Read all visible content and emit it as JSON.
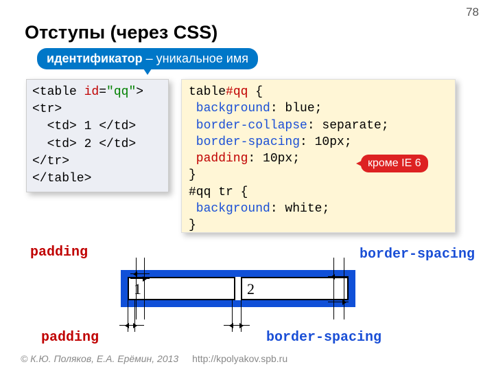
{
  "page_number": "78",
  "title": "Отступы (через CSS)",
  "callout_top": {
    "id_word": "идентификатор",
    "rest": " – уникальное имя"
  },
  "html_code": {
    "l1a": "<table ",
    "l1b": "id",
    "l1c": "=",
    "l1d": "\"qq\"",
    "l1e": ">",
    "l2": "<tr>",
    "l3": "  <td> 1 </td>",
    "l4": "  <td> 2 </td>",
    "l5": "</tr>",
    "l6": "</table>"
  },
  "css_code": {
    "l1a": "table",
    "l1b": "#qq",
    "l1c": " {",
    "l2a": " background",
    "l2b": ": blue;",
    "l3a": " border-collapse",
    "l3b": ": separate;",
    "l4a": " border-spacing",
    "l4b": ": 10px;",
    "l5a": " padding",
    "l5b": ": 10px;",
    "l6": "}",
    "l7": "#qq tr {",
    "l8a": " background",
    "l8b": ": white;",
    "l9": "}"
  },
  "callout_red": "кроме IE 6",
  "diagram": {
    "cell1": "1",
    "cell2": "2"
  },
  "labels": {
    "padding_top": "padding",
    "padding_bottom": "padding",
    "bspacing_top": "border-spacing",
    "bspacing_bottom": "border-spacing"
  },
  "footer": {
    "copyright": "© К.Ю. Поляков, Е.А. Ерёмин, 2013",
    "link": "http://kpolyakov.spb.ru"
  }
}
